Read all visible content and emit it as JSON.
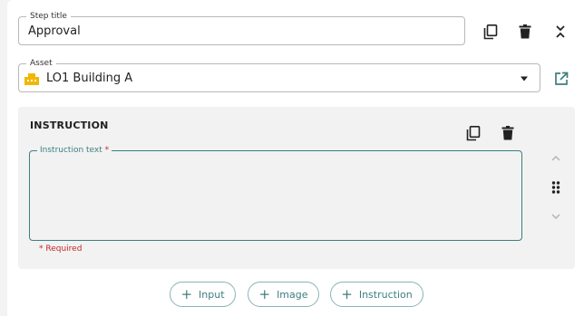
{
  "step": {
    "title_label": "Step title",
    "title_value": "Approval"
  },
  "asset": {
    "label": "Asset",
    "value": "LO1 Building A"
  },
  "instruction": {
    "heading": "INSTRUCTION",
    "text_label": "Instruction text",
    "required_star": "*",
    "required_hint": "* Required"
  },
  "add_buttons": {
    "input": "Input",
    "image": "Image",
    "instruction": "Instruction",
    "plus": "+"
  },
  "icons": {
    "copy": "copy-icon",
    "delete": "trash-icon",
    "collapse": "collapse-icon",
    "dropdown": "caret-down-icon",
    "open_external": "open-in-new-icon",
    "drag": "drag-handle-icon",
    "move_up": "chevron-up-icon",
    "move_down": "chevron-down-icon",
    "building": "building-icon"
  },
  "colors": {
    "accent": "#3d7f81",
    "required": "#c62828",
    "building_icon": "#f2b705"
  }
}
